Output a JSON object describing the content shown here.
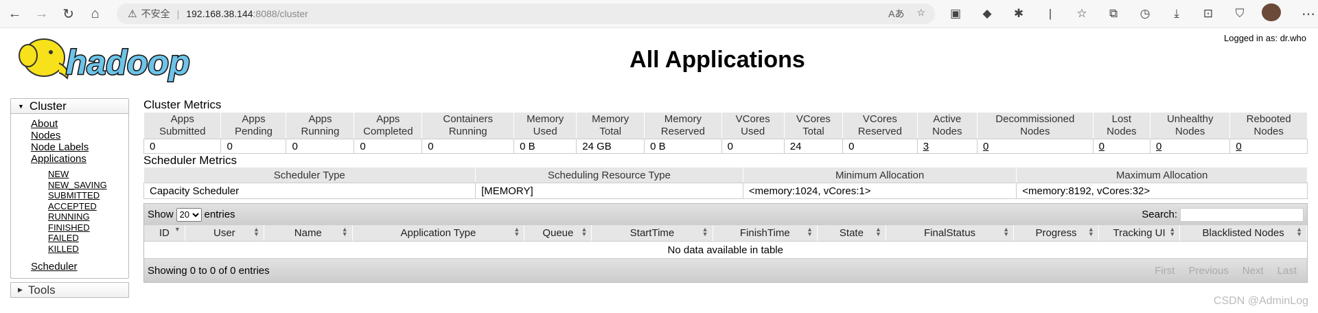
{
  "browser": {
    "insecure_label": "不安全",
    "url_host": "192.168.38.144",
    "url_port_path": ":8088/cluster"
  },
  "header": {
    "logged_in": "Logged in as: dr.who",
    "title": "All Applications"
  },
  "sidebar": {
    "cluster_label": "Cluster",
    "links": [
      "About",
      "Nodes",
      "Node Labels",
      "Applications"
    ],
    "app_states": [
      "NEW",
      "NEW_SAVING",
      "SUBMITTED",
      "ACCEPTED",
      "RUNNING",
      "FINISHED",
      "FAILED",
      "KILLED"
    ],
    "scheduler_link": "Scheduler",
    "tools_label": "Tools"
  },
  "cluster_metrics": {
    "title": "Cluster Metrics",
    "headers": [
      [
        "Apps",
        "Submitted"
      ],
      [
        "Apps",
        "Pending"
      ],
      [
        "Apps",
        "Running"
      ],
      [
        "Apps",
        "Completed"
      ],
      [
        "Containers",
        "Running"
      ],
      [
        "Memory",
        "Used"
      ],
      [
        "Memory",
        "Total"
      ],
      [
        "Memory",
        "Reserved"
      ],
      [
        "VCores",
        "Used"
      ],
      [
        "VCores",
        "Total"
      ],
      [
        "VCores",
        "Reserved"
      ],
      [
        "Active",
        "Nodes"
      ],
      [
        "Decommissioned",
        "Nodes"
      ],
      [
        "Lost",
        "Nodes"
      ],
      [
        "Unhealthy",
        "Nodes"
      ],
      [
        "Rebooted",
        "Nodes"
      ]
    ],
    "values": [
      "0",
      "0",
      "0",
      "0",
      "0",
      "0 B",
      "24 GB",
      "0 B",
      "0",
      "24",
      "0",
      "3",
      "0",
      "0",
      "0",
      "0"
    ]
  },
  "scheduler_metrics": {
    "title": "Scheduler Metrics",
    "headers": [
      "Scheduler Type",
      "Scheduling Resource Type",
      "Minimum Allocation",
      "Maximum Allocation"
    ],
    "values": [
      "Capacity Scheduler",
      "[MEMORY]",
      "<memory:1024, vCores:1>",
      "<memory:8192, vCores:32>"
    ]
  },
  "apps_table": {
    "show_label": "Show",
    "entries_label": "entries",
    "page_size": "20",
    "search_label": "Search:",
    "columns": [
      "ID",
      "User",
      "Name",
      "Application Type",
      "Queue",
      "StartTime",
      "FinishTime",
      "State",
      "FinalStatus",
      "Progress",
      "Tracking UI",
      "Blacklisted Nodes"
    ],
    "empty_message": "No data available in table",
    "info": "Showing 0 to 0 of 0 entries",
    "pager": [
      "First",
      "Previous",
      "Next",
      "Last"
    ]
  },
  "watermark": "CSDN @AdminLog"
}
